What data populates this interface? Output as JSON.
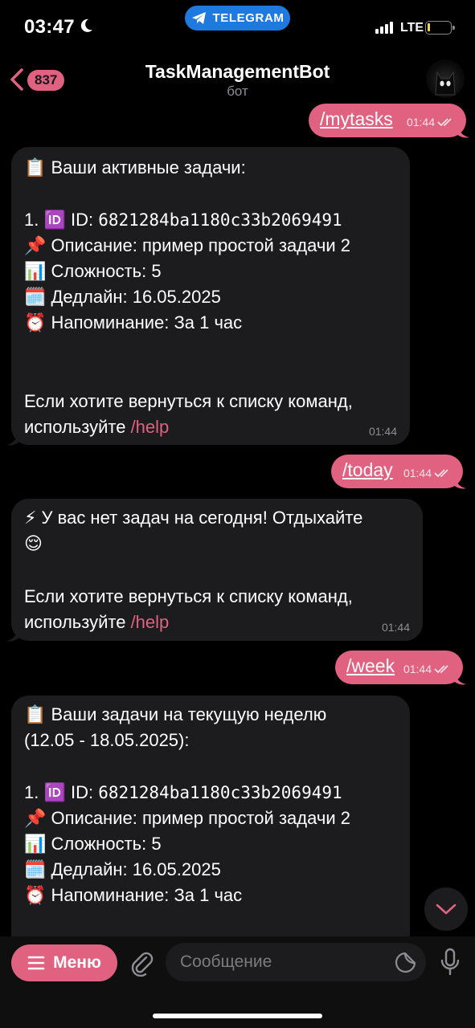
{
  "status": {
    "time": "03:47",
    "pill_label": "TELEGRAM",
    "network": "LTE",
    "battery_level": 0.12
  },
  "header": {
    "back_count": "837",
    "title": "TaskManagementBot",
    "subtitle": "бот"
  },
  "messages": {
    "m1": {
      "command": "/mytasks",
      "time": "01:44"
    },
    "m2": {
      "heading": "📋 Ваши активные задачи:",
      "item_prefix": "1. 🆔 ID: ",
      "item_id": "6821284ba1180c33b2069491",
      "desc": "📌 Описание: пример простой задачи 2",
      "complexity": "📊 Сложность: 5",
      "deadline": "🗓️ Дедлайн: 16.05.2025",
      "reminder": "⏰ Напоминание: За 1 час",
      "footer_1": "Если хотите вернуться к списку команд,",
      "footer_2": "используйте ",
      "link": "/help",
      "time": "01:44"
    },
    "m3": {
      "command": "/today",
      "time": "01:44"
    },
    "m4": {
      "line_1": "⚡ У вас нет задач на сегодня! Отдыхайте",
      "line_2": "😌",
      "footer_1": "Если хотите вернуться к списку команд,",
      "footer_2": "используйте ",
      "link": "/help",
      "time": "01:44"
    },
    "m5": {
      "command": "/week",
      "time": "01:44"
    },
    "m6": {
      "heading": "📋 Ваши задачи на текущую неделю",
      "range": "(12.05 - 18.05.2025):",
      "item_prefix": "1. 🆔 ID: ",
      "item_id": "6821284ba1180c33b2069491",
      "desc": "📌 Описание: пример простой задачи 2",
      "complexity": "📊 Сложность: 5",
      "deadline": "🗓️ Дедлайн: 16.05.2025",
      "reminder": "⏰ Напоминание: За 1 час"
    }
  },
  "input": {
    "menu_label": "Меню",
    "placeholder": "Сообщение"
  },
  "colors": {
    "accent": "#e06180",
    "bubble_in": "#1c1c1e",
    "pill": "#1f7ae0"
  },
  "icons": [
    "moon-icon",
    "telegram-icon",
    "signal-icon",
    "battery-icon",
    "back-chevron-icon",
    "avatar",
    "double-check-icon",
    "scroll-down-icon",
    "menu-icon",
    "attach-icon",
    "sticker-icon",
    "mic-icon"
  ]
}
